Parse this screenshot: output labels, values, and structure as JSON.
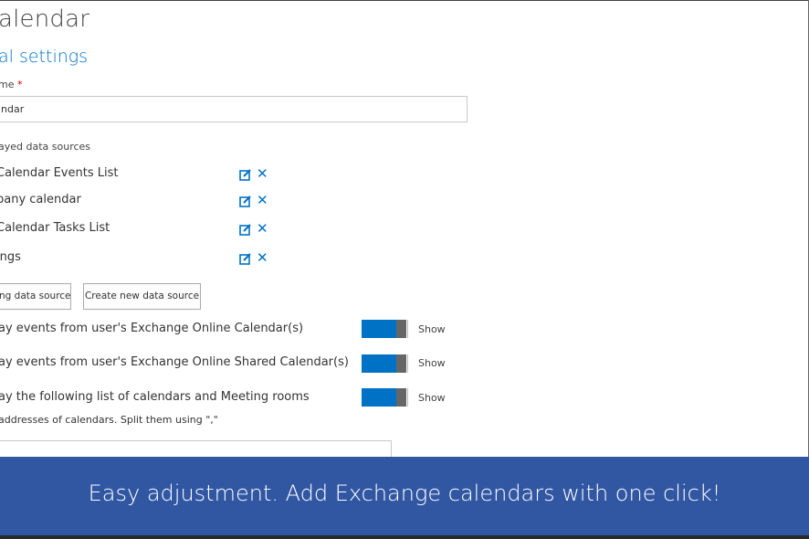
{
  "page": {
    "title": "alendar"
  },
  "section": {
    "title": "al settings"
  },
  "name_field": {
    "label": "me",
    "required_mark": "*",
    "value": "ndar"
  },
  "data_sources": {
    "label": "ayed data sources",
    "items": [
      {
        "label": "Calendar Events List"
      },
      {
        "label": "pany calendar"
      },
      {
        "label": "Calendar Tasks List"
      },
      {
        "label": "ings"
      }
    ]
  },
  "buttons": {
    "existing": "ng data source",
    "create_new": "Create new data source"
  },
  "options": [
    {
      "label": "ay events from user's Exchange Online Calendar(s)",
      "toggle_text": "Show",
      "state": "on"
    },
    {
      "label": "ay events from user's Exchange Online Shared Calendar(s)",
      "toggle_text": "Show",
      "state": "on"
    },
    {
      "label": "ay the following list of calendars and Meeting rooms",
      "toggle_text": "Show",
      "state": "on"
    }
  ],
  "emails": {
    "hint": "addresses of calendars. Split them using \",\"",
    "value": ""
  },
  "banner": {
    "text": "Easy adjustment. Add Exchange calendars with one click!"
  },
  "colors": {
    "accent": "#0072c6",
    "banner": "#3157a3",
    "toggle_thumb": "#666666"
  }
}
